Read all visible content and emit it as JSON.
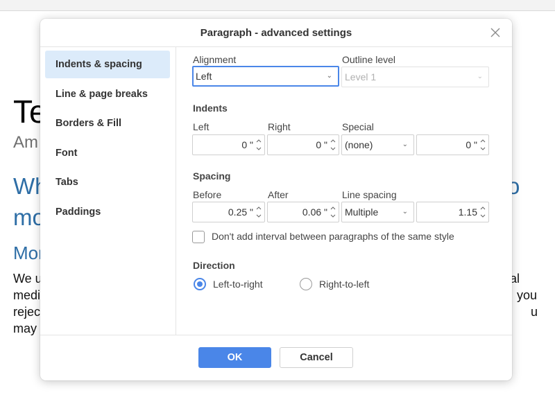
{
  "background_doc": {
    "title": "Te",
    "subtitle": "Am",
    "heading_line1": "Wh",
    "heading_line1_right": "o",
    "heading_line2": "mo",
    "heading2": "Mor",
    "body_lines": [
      "We u",
      "medi",
      "rejec",
      "may"
    ],
    "body_right": [
      "al",
      "you",
      "u"
    ]
  },
  "dialog": {
    "title": "Paragraph - advanced settings",
    "close_icon": "close-icon",
    "sidebar": [
      {
        "label": "Indents & spacing",
        "active": true
      },
      {
        "label": "Line & page breaks",
        "active": false
      },
      {
        "label": "Borders & Fill",
        "active": false
      },
      {
        "label": "Font",
        "active": false
      },
      {
        "label": "Tabs",
        "active": false
      },
      {
        "label": "Paddings",
        "active": false
      }
    ],
    "alignment": {
      "label": "Alignment",
      "value": "Left"
    },
    "outline": {
      "label": "Outline level",
      "value": "Level 1"
    },
    "indents": {
      "title": "Indents",
      "left": {
        "label": "Left",
        "value": "0 \""
      },
      "right": {
        "label": "Right",
        "value": "0 \""
      },
      "special": {
        "label": "Special",
        "value": "(none)"
      },
      "special_amount": {
        "value": "0 \""
      }
    },
    "spacing": {
      "title": "Spacing",
      "before": {
        "label": "Before",
        "value": "0.25 \""
      },
      "after": {
        "label": "After",
        "value": "0.06 \""
      },
      "line": {
        "label": "Line spacing",
        "value": "Multiple"
      },
      "line_amount": {
        "value": "1.15"
      }
    },
    "no_interval": {
      "label": "Don't add interval between paragraphs of the same style",
      "checked": false
    },
    "direction": {
      "title": "Direction",
      "options": [
        {
          "label": "Left-to-right",
          "selected": true
        },
        {
          "label": "Right-to-left",
          "selected": false
        }
      ]
    },
    "buttons": {
      "ok": "OK",
      "cancel": "Cancel"
    },
    "colors": {
      "accent": "#4a86e8",
      "sidebar_active": "#dcebfa",
      "doc_heading": "#2e6ea6"
    }
  }
}
